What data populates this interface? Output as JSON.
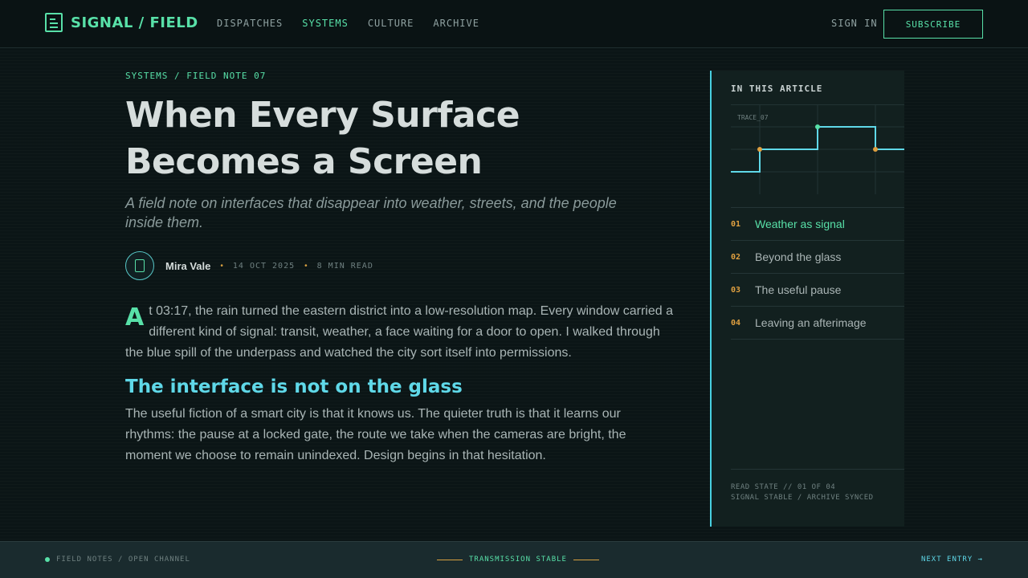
{
  "header": {
    "logo_text": "SIGNAL / FIELD",
    "logo_icon": "document-icon",
    "nav": [
      {
        "label": "DISPATCHES",
        "active": false
      },
      {
        "label": "SYSTEMS",
        "active": true
      },
      {
        "label": "CULTURE",
        "active": false
      },
      {
        "label": "ARCHIVE",
        "active": false
      }
    ],
    "signin_label": "SIGN IN",
    "subscribe_label": "SUBSCRIBE"
  },
  "article": {
    "kicker": "SYSTEMS / FIELD NOTE 07",
    "title": "When Every Surface Becomes a Screen",
    "subtitle": "A field note on interfaces that disappear into weather, streets, and the people inside them.",
    "author": "Mira Vale",
    "date": "14 OCT 2025",
    "read_time": "8 MIN READ",
    "dropcap": "A",
    "lede": "t 03:17, the rain turned the eastern district into a low-resolution map. Every window carried a different kind of signal: transit, weather, a face waiting for a door to open. I walked through the blue spill of the underpass and watched the city sort itself into permissions.",
    "section_heading": "The interface is not on the glass",
    "paragraph": "The useful fiction of a smart city is that it knows us. The quieter truth is that it learns our rhythms: the pause at a locked gate, the route we take when the cameras are bright, the moment we choose to remain unindexed. Design begins in that hesitation."
  },
  "sidebar": {
    "heading": "IN THIS ARTICLE",
    "trace_label": "TRACE_07",
    "toc": [
      {
        "num": "01",
        "label": "Weather as signal",
        "active": true
      },
      {
        "num": "02",
        "label": "Beyond the glass",
        "active": false
      },
      {
        "num": "03",
        "label": "The useful pause",
        "active": false
      },
      {
        "num": "04",
        "label": "Leaving an afterimage",
        "active": false
      }
    ],
    "footer_line1": "READ STATE // 01 OF 04",
    "footer_line2": "SIGNAL STABLE / ARCHIVE SYNCED"
  },
  "footer": {
    "left_text": "FIELD NOTES / OPEN CHANNEL",
    "center_text": "TRANSMISSION STABLE",
    "right_text": "NEXT ENTRY →"
  },
  "colors": {
    "accent_green": "#58e0a8",
    "accent_cyan": "#5fd8e8",
    "accent_amber": "#e0a040",
    "background": "#0b1516"
  }
}
